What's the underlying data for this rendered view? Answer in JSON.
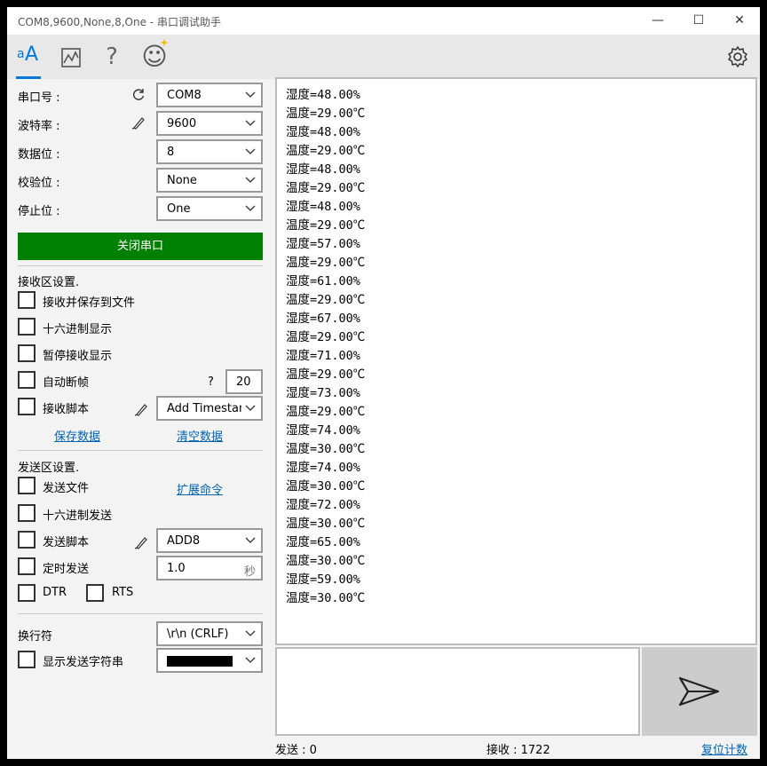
{
  "window": {
    "title": "COM8,9600,None,8,One - 串口调试助手"
  },
  "titlebar": {
    "min": "—",
    "max": "☐",
    "close": "✕"
  },
  "toolbar": {
    "text_tab": "A",
    "chart_tab": "",
    "help_tab": "?",
    "emoji_tab": "☺"
  },
  "serial": {
    "port_label": "串口号 :",
    "port_value": "COM8",
    "baud_label": "波特率 :",
    "baud_value": "9600",
    "databits_label": "数据位 :",
    "databits_value": "8",
    "parity_label": "校验位 :",
    "parity_value": "None",
    "stopbits_label": "停止位 :",
    "stopbits_value": "One",
    "toggle_button": "关闭串口"
  },
  "receive_settings": {
    "header": "接收区设置.",
    "save_to_file": "接收并保存到文件",
    "hex_display": "十六进制显示",
    "pause_display": "暂停接收显示",
    "auto_break": "自动断帧",
    "auto_break_help": "?",
    "auto_break_value": "20",
    "script_label": "接收脚本",
    "script_value": "Add Timestamp",
    "save_data": "保存数据",
    "clear_data": "清空数据"
  },
  "send_settings": {
    "header": "发送区设置.",
    "send_file": "发送文件",
    "extend_cmd": "扩展命令",
    "hex_send": "十六进制发送",
    "script_label": "发送脚本",
    "script_value": "ADD8",
    "timed_send": "定时发送",
    "timed_value": "1.0",
    "timed_unit": "秒",
    "dtr": "DTR",
    "rts": "RTS"
  },
  "newline": {
    "label": "换行符",
    "value": "\\r\\n (CRLF)",
    "show_send_label": "显示发送字符串"
  },
  "receive_area": {
    "lines": [
      "湿度=48.00%",
      "温度=29.00℃",
      "湿度=48.00%",
      "温度=29.00℃",
      "湿度=48.00%",
      "温度=29.00℃",
      "湿度=48.00%",
      "温度=29.00℃",
      "湿度=57.00%",
      "温度=29.00℃",
      "湿度=61.00%",
      "温度=29.00℃",
      "湿度=67.00%",
      "温度=29.00℃",
      "湿度=71.00%",
      "温度=29.00℃",
      "湿度=73.00%",
      "温度=29.00℃",
      "湿度=74.00%",
      "温度=30.00℃",
      "湿度=74.00%",
      "温度=30.00℃",
      "湿度=72.00%",
      "温度=30.00℃",
      "湿度=65.00%",
      "温度=30.00℃",
      "湿度=59.00%",
      "温度=30.00℃"
    ]
  },
  "status": {
    "sent": "发送 : 0",
    "received": "接收 : 1722",
    "reset": "复位计数"
  },
  "colors": {
    "accent": "#0078d7",
    "open_button": "#008000",
    "link": "#0063b1"
  }
}
